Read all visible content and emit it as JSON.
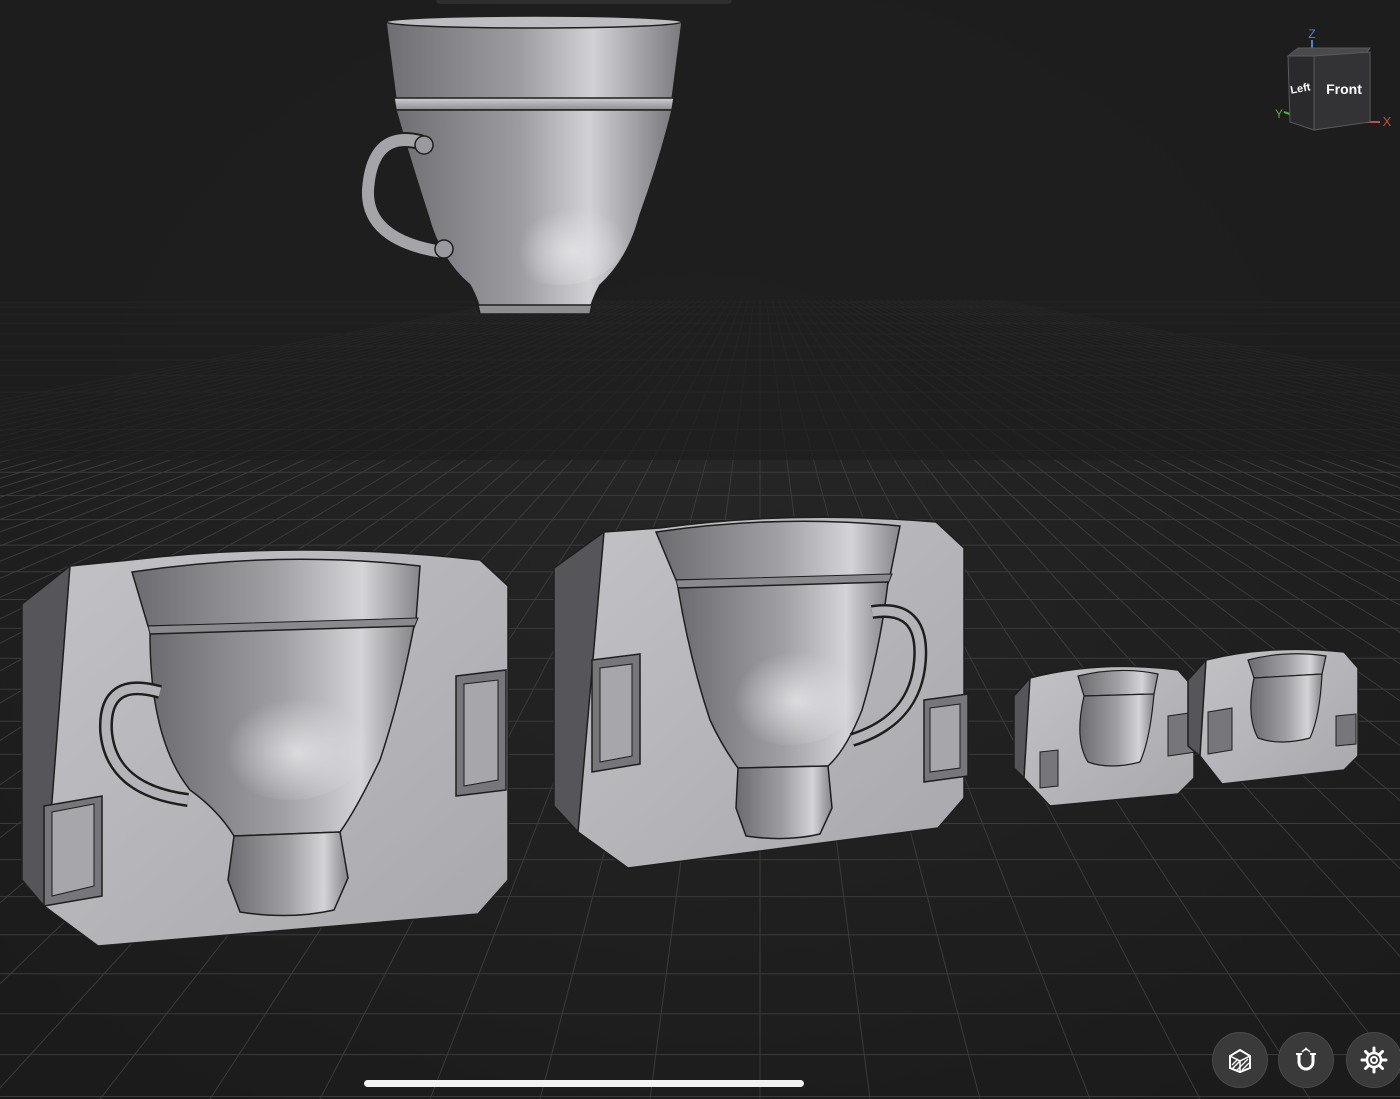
{
  "viewport": {
    "background": "#1e1e1e",
    "grid_color": "#3b3b3b",
    "model_color": "#a7a7ab"
  },
  "view_cube": {
    "front_label": "Front",
    "left_label": "Left",
    "axes": {
      "x": {
        "label": "X",
        "color": "#c0503e"
      },
      "y": {
        "label": "Y",
        "color": "#5da84a"
      },
      "z": {
        "label": "Z",
        "color": "#4a86d4"
      }
    }
  },
  "objects": [
    {
      "name": "teacup-model"
    },
    {
      "name": "mold-half-large-left"
    },
    {
      "name": "mold-half-large-right"
    },
    {
      "name": "mold-foot-small-left"
    },
    {
      "name": "mold-foot-small-right"
    }
  ],
  "toolbar": {
    "buttons": [
      {
        "icon": "section-view-icon"
      },
      {
        "icon": "magnet-snap-icon"
      },
      {
        "icon": "gear-icon"
      }
    ]
  }
}
